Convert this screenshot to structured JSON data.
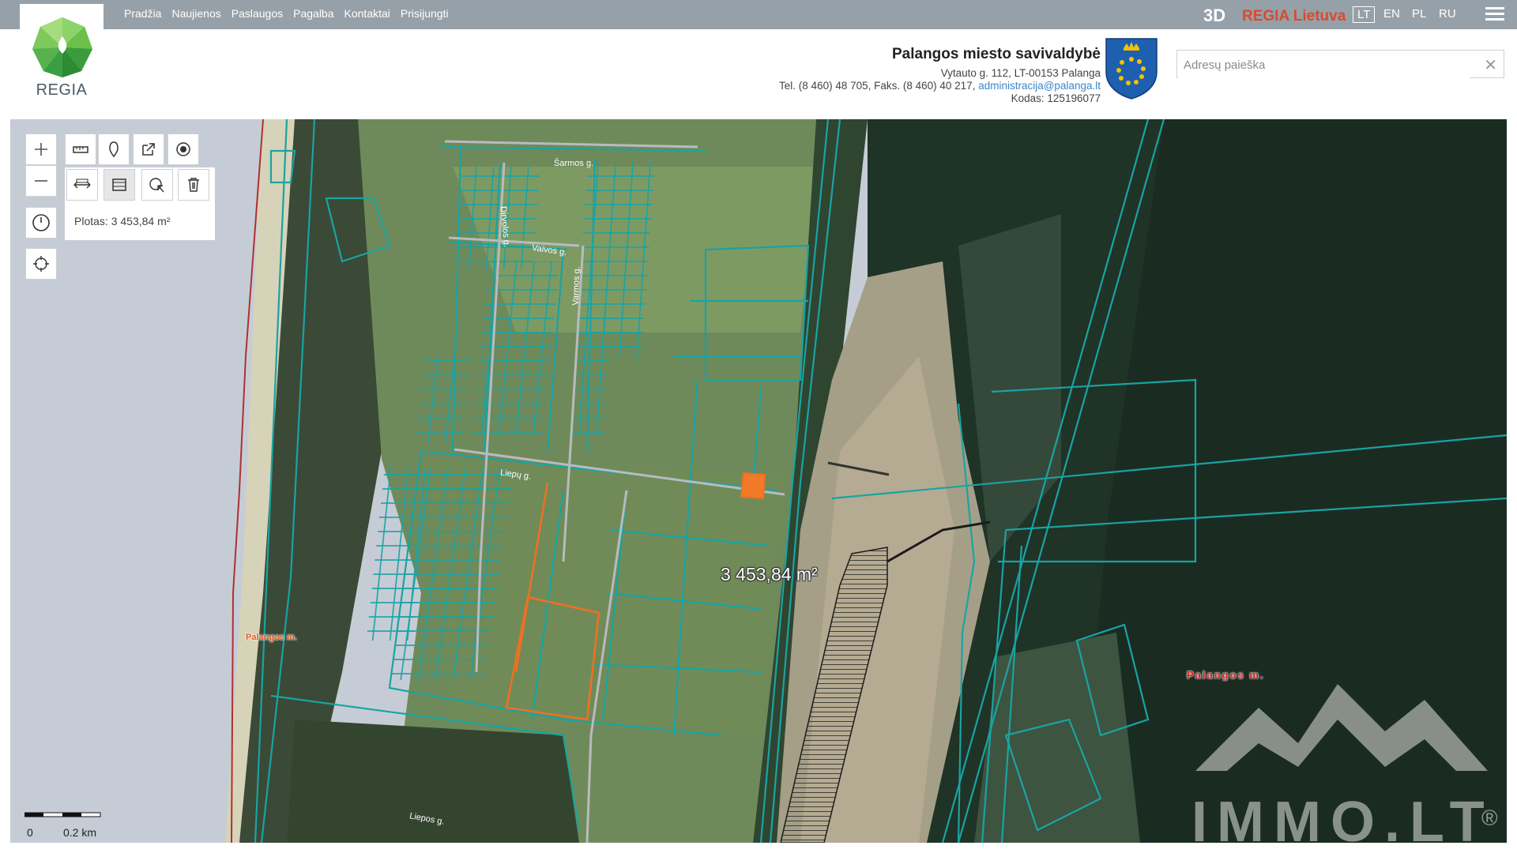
{
  "nav": {
    "items": [
      "Pradžia",
      "Naujienos",
      "Paslaugos",
      "Pagalba",
      "Kontaktai",
      "Prisijungti"
    ]
  },
  "topright": {
    "btn_3d": "3D",
    "regia_lt": "REGIA Lietuva",
    "langs": [
      "LT",
      "EN",
      "PL",
      "RU"
    ],
    "active_lang": "LT"
  },
  "logo": {
    "text": "REGIA"
  },
  "org": {
    "name": "Palangos miesto savivaldybė",
    "address": "Vytauto g. 112, LT-00153 Palanga",
    "phone": "Tel. (8 460) 48 705, Faks. (8 460) 40 217, ",
    "email": "administracija@palanga.lt",
    "code": "Kodas: 125196077"
  },
  "search": {
    "placeholder": "Adresų paieška",
    "value": ""
  },
  "map": {
    "measure_panel_text": "Plotas: 3 453,84 m²",
    "measure_label": "3 453,84 m²",
    "place_labels": [
      "Palangos m.",
      "Palangos m."
    ],
    "street_labels": [
      "Šarmos g.",
      "Vaivos g.",
      "Dirvolos g.",
      "Varmos g.",
      "Liepų g.",
      "Liepos g."
    ],
    "scale": {
      "left": "0",
      "right": "0.2 km"
    }
  },
  "watermark": {
    "text": "IMMO.LT",
    "reg": "®"
  },
  "colors": {
    "topbar": "#96a0a8",
    "parcel_lines": "#1aa3a3",
    "selected_parcel": "#f07020",
    "place_label": "#e02020"
  }
}
